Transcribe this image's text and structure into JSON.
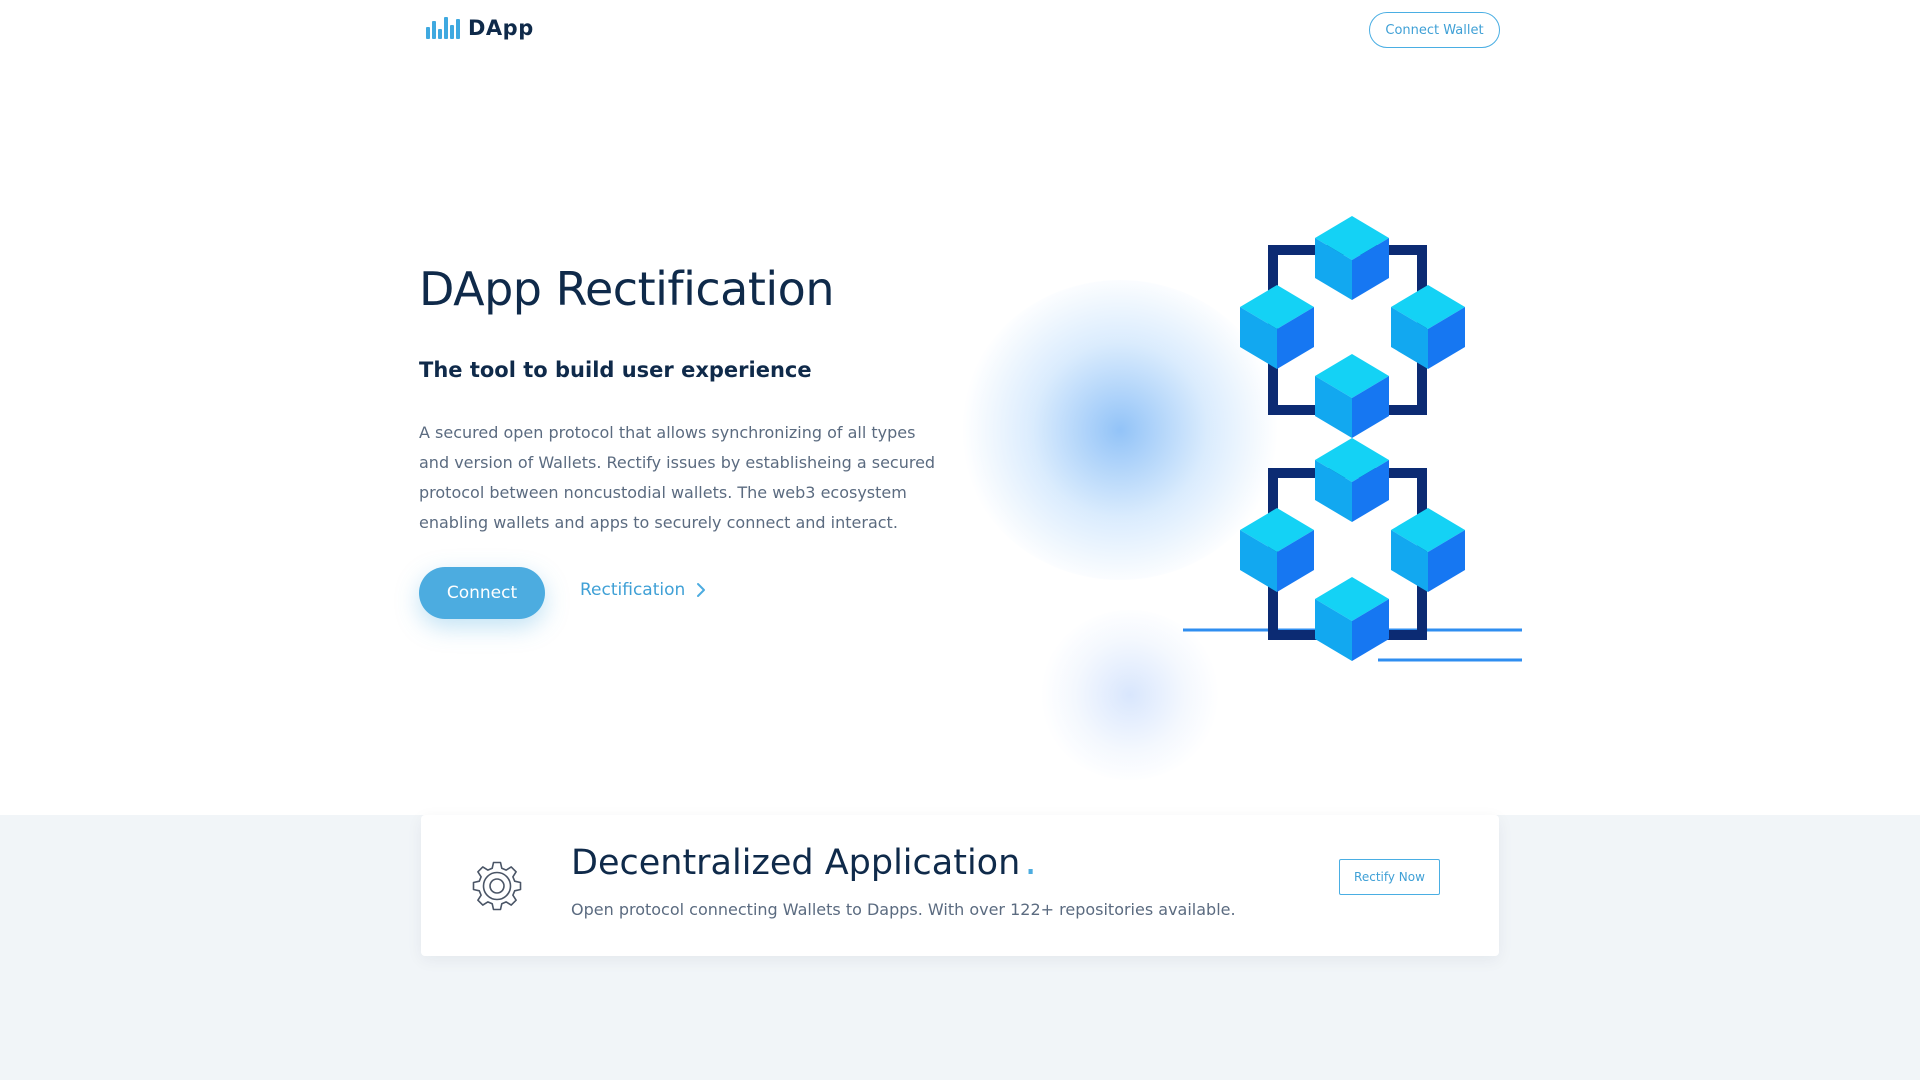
{
  "header": {
    "logo_text": "DApp",
    "connect_wallet_label": "Connect Wallet"
  },
  "hero": {
    "title": "DApp Rectification",
    "subtitle": "The tool to build user experience",
    "description": "A secured open protocol that allows synchronizing of all types and version of Wallets. Rectify issues by establisheing a secured protocol between noncustodial wallets. The web3 ecosystem enabling wallets and apps to securely connect and interact.",
    "connect_label": "Connect",
    "rectification_label": "Rectification"
  },
  "feature_card": {
    "title": "Decentralized Application",
    "title_dot": ".",
    "description": "Open protocol connecting Wallets to Dapps. With over 122+ repositories available.",
    "button_label": "Rectify Now"
  },
  "icons": {
    "logo": "bar-chart-logo-icon",
    "rectification_arrow": "chevron-right-icon",
    "card_icon": "gear-icon",
    "illustration": "blockchain-cubes-illustration"
  },
  "colors": {
    "accent": "#4cace0",
    "heading": "#0f2a4a",
    "body_text": "#5b6b80",
    "section_bg": "#f1f5f8",
    "cube_light": "#14d2f5",
    "cube_mid": "#12a8f0",
    "cube_dark": "#1677f2",
    "frame_navy": "#0c2b73"
  }
}
